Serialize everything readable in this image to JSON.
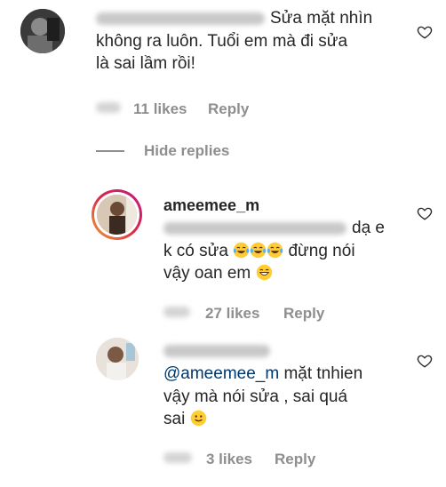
{
  "comments": [
    {
      "username_hidden": true,
      "text": "Sửa mặt nhìn không ra luôn. Tuổi em mà đi sửa là sai lầm rồi!",
      "lines": [
        "Sửa mặt nhìn",
        "không ra luôn. Tuổi em mà đi sửa",
        "là sai lầm rồi!"
      ],
      "likes": "11 likes",
      "reply": "Reply",
      "hide_replies": "Hide replies"
    }
  ],
  "replies": [
    {
      "username": "ameemee_m",
      "line1_suffix": "dạ e",
      "line2_a": "k có sửa ",
      "line2_b": " đừng nói",
      "line3": "vậy oan em ",
      "likes": "27 likes",
      "reply": "Reply"
    },
    {
      "username_hidden": true,
      "mention": "@ameemee_m",
      "line1_rest": " mặt tnhien",
      "line2": "vậy mà nói sửa , sai quá",
      "line3": "sai ",
      "likes": "3 likes",
      "reply": "Reply"
    }
  ],
  "icons": {
    "heart": "heart-outline-icon",
    "laugh": "tears-of-joy-emoji",
    "grin": "grinning-emoji",
    "smile": "slightly-smiling-emoji"
  },
  "colors": {
    "text": "#262626",
    "meta": "#8e8e8e",
    "mention": "#00376b",
    "story_ring_start": "#c13584",
    "story_ring_end": "#fd1d1d"
  }
}
